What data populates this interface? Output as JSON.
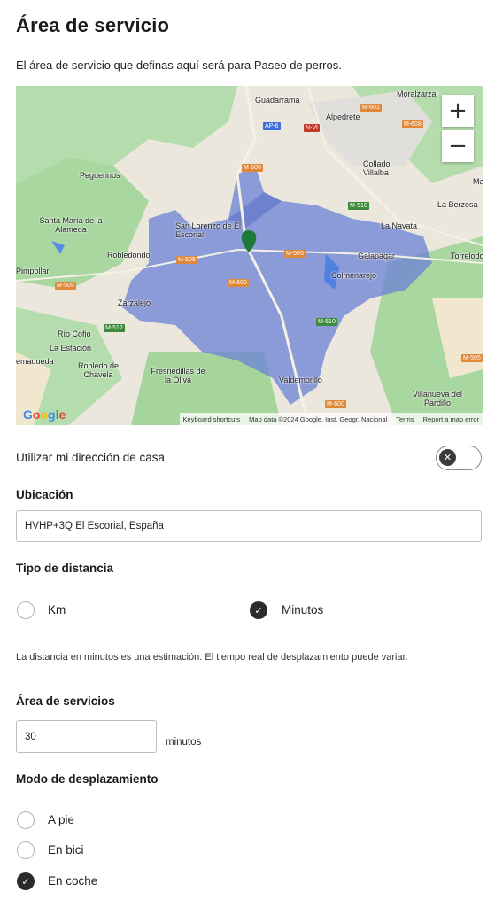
{
  "header": {
    "title": "Área de servicio",
    "subtitle": "El área de servicio que definas aquí será para Paseo de perros."
  },
  "map": {
    "zoom_in": "+",
    "zoom_out": "−",
    "google_logo": "Google",
    "attribution": {
      "shortcuts": "Keyboard shortcuts",
      "data": "Map data ©2024 Google, Inst. Geogr. Nacional",
      "terms": "Terms",
      "report": "Report a map error"
    },
    "places": [
      "Guadarrama",
      "Moralzarzal",
      "Alpedrete",
      "Collado Villalba",
      "Peguerinos",
      "Santa María de la Alameda",
      "San Lorenzo de El Escorial",
      "La Navata",
      "La Berzosa",
      "Robledondo",
      "Galapagar",
      "Torrelodones",
      "Pimpollar",
      "Colmenarejo",
      "Zarzalejo",
      "Río Cofio",
      "La Estación",
      "Robledo de Chavela",
      "emaqueda",
      "Valdemorillo",
      "Fresnedillas de la Oliva",
      "Villanueva del Pardillo",
      "Ma"
    ],
    "roads": [
      "M-601",
      "M-608",
      "AP-6",
      "N-VI",
      "M-600",
      "M-510",
      "M-505",
      "M-505",
      "M-505",
      "M-600",
      "M-510",
      "M-512",
      "M-505",
      "M-600"
    ],
    "colors": {
      "area": "#6e85d6",
      "pin": "#1e7a3a",
      "green": "#a8d6a2",
      "sand": "#efe6d2"
    }
  },
  "home_address": {
    "label": "Utilizar mi dirección de casa",
    "toggle_state": "off",
    "toggle_icon": "close-icon"
  },
  "location": {
    "label": "Ubicación",
    "value": "HVHP+3Q El Escorial, España"
  },
  "distance_type": {
    "label": "Tipo de distancia",
    "options": [
      {
        "label": "Km",
        "selected": false
      },
      {
        "label": "Minutos",
        "selected": true
      }
    ],
    "note": "La distancia en minutos es una estimación. El tiempo real de desplazamiento puede variar."
  },
  "service_area": {
    "label": "Área de servicios",
    "value": "30",
    "unit": "minutos"
  },
  "travel_mode": {
    "label": "Modo de desplazamiento",
    "options": [
      {
        "label": "A pie",
        "selected": false
      },
      {
        "label": "En bici",
        "selected": false
      },
      {
        "label": "En coche",
        "selected": true
      }
    ]
  }
}
